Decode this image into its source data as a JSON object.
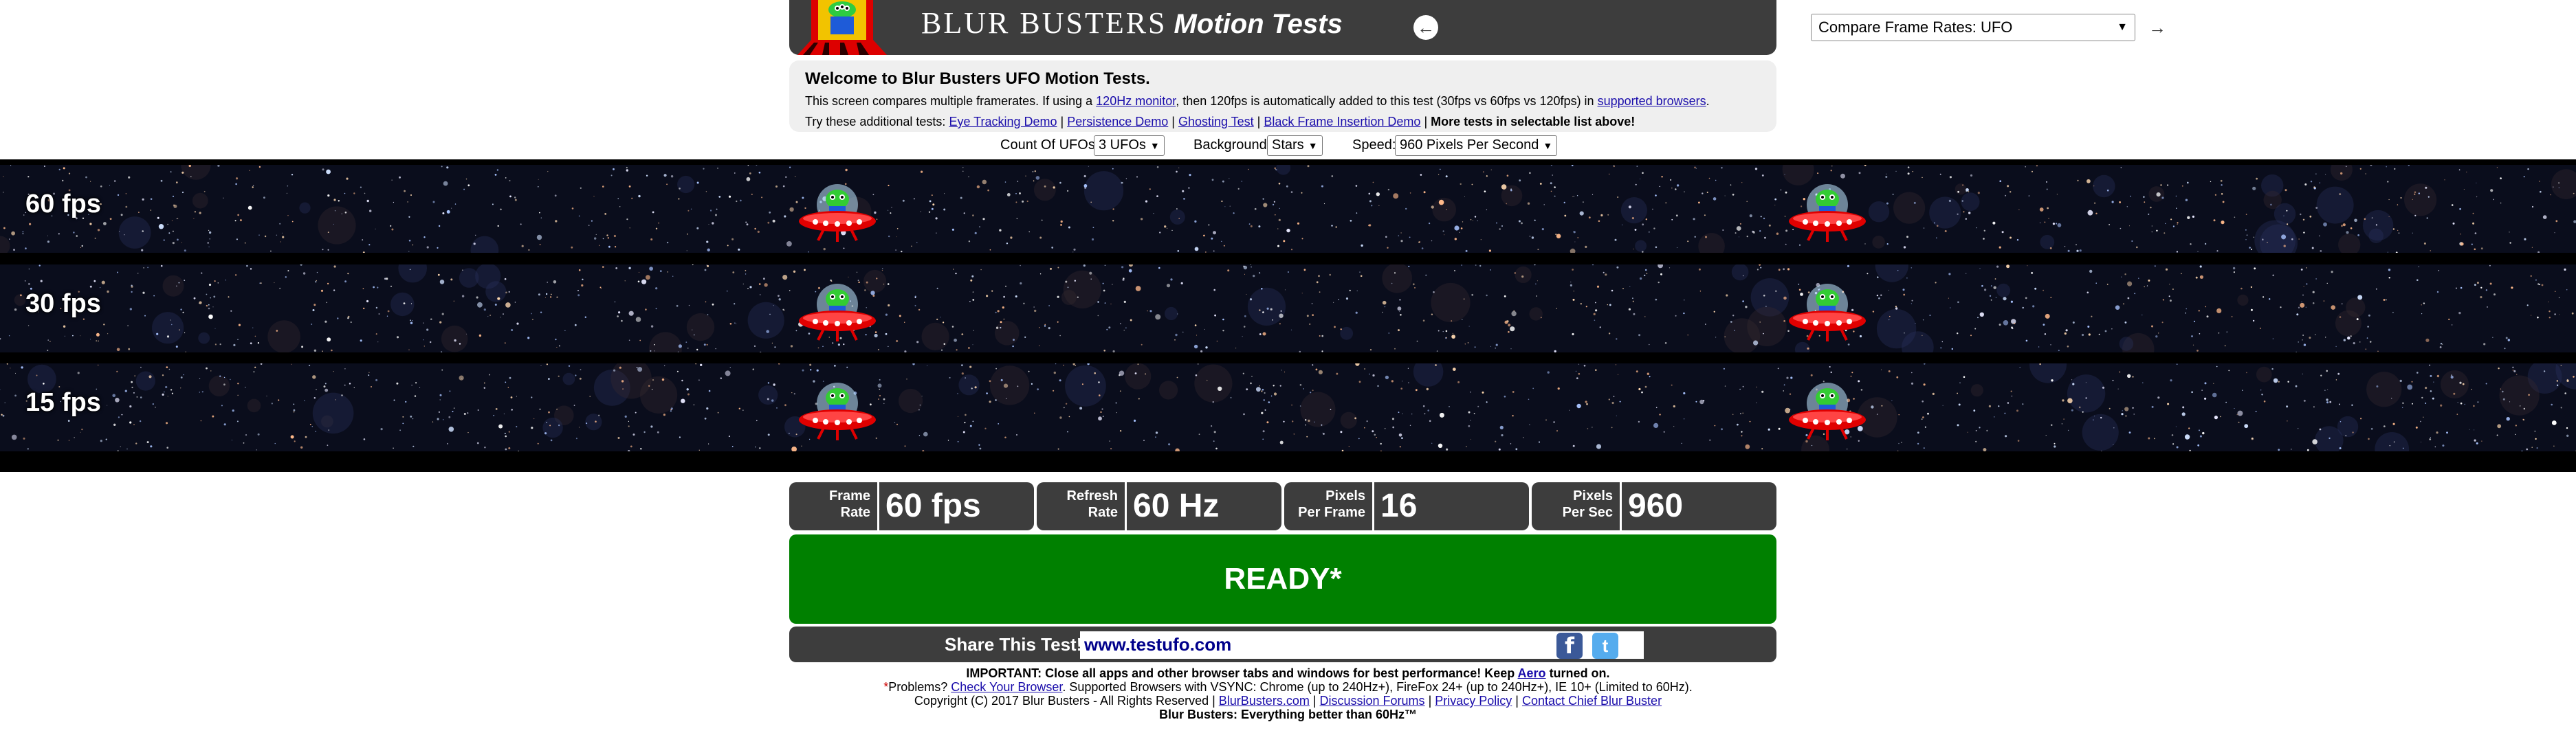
{
  "header": {
    "title_main": "BLUR BUSTERS",
    "title_sub": "Motion Tests",
    "prev_icon": "left-arrow-icon",
    "next_icon": "right-arrow-icon",
    "test_select_value": "Compare Frame Rates: UFO"
  },
  "info": {
    "heading": "Welcome to Blur Busters UFO Motion Tests.",
    "line1_a": "This screen compares multiple framerates. If using a ",
    "line1_link1": "120Hz monitor",
    "line1_b": ", then 120fps is automatically added to this test (30fps vs 60fps vs 120fps) in ",
    "line1_link2": "supported browsers",
    "line1_c": ".",
    "line2_a": "Try these additional tests: ",
    "link_eye": "Eye Tracking Demo",
    "link_persist": "Persistence Demo",
    "link_ghost": "Ghosting Test",
    "link_bfi": "Black Frame Insertion Demo",
    "sep": " | ",
    "more_tests": "More tests in selectable list above!"
  },
  "settings": {
    "count_label": "Count Of UFOs:",
    "count_value": "3 UFOs",
    "background_label": "Background:",
    "background_value": "Stars",
    "speed_label": "Speed:",
    "speed_value": "960 Pixels Per Second"
  },
  "lanes": [
    {
      "label": "60 fps"
    },
    {
      "label": "30 fps"
    },
    {
      "label": "15 fps"
    }
  ],
  "stats": {
    "frame_rate_label_1": "Frame",
    "frame_rate_label_2": "Rate",
    "frame_rate_value": "60 fps",
    "refresh_label_1": "Refresh",
    "refresh_label_2": "Rate",
    "refresh_value": "60 Hz",
    "ppf_label_1": "Pixels",
    "ppf_label_2": "Per Frame",
    "ppf_value": "16",
    "pps_label_1": "Pixels",
    "pps_label_2": "Per Sec",
    "pps_value": "960"
  },
  "ready": {
    "text": "READY*"
  },
  "share": {
    "label": "Share This Test!",
    "url": "www.testufo.com",
    "facebook_icon": "facebook-icon",
    "twitter_icon": "twitter-icon"
  },
  "footer": {
    "important_a": "IMPORTANT: Close all apps and other browser tabs and windows for best performance! Keep ",
    "aero_link": "Aero",
    "important_b": " turned on.",
    "star": "*",
    "problems": "Problems? ",
    "check_browser": "Check Your Browser",
    "supported": ". Supported Browsers with VSYNC: Chrome (up to 240Hz+), FireFox 24+ (up to 240Hz+), IE 10+ (Limited to 60Hz).",
    "copyright": "Copyright (C) 2017 Blur Busters - All Rights Reserved | ",
    "link_bb": "BlurBusters.com",
    "link_forums": "Discussion Forums",
    "link_privacy": "Privacy Policy",
    "link_contact": "Contact Chief Blur Buster",
    "sep": " | ",
    "tagline": "Blur Busters: Everything better than 60Hz™"
  }
}
